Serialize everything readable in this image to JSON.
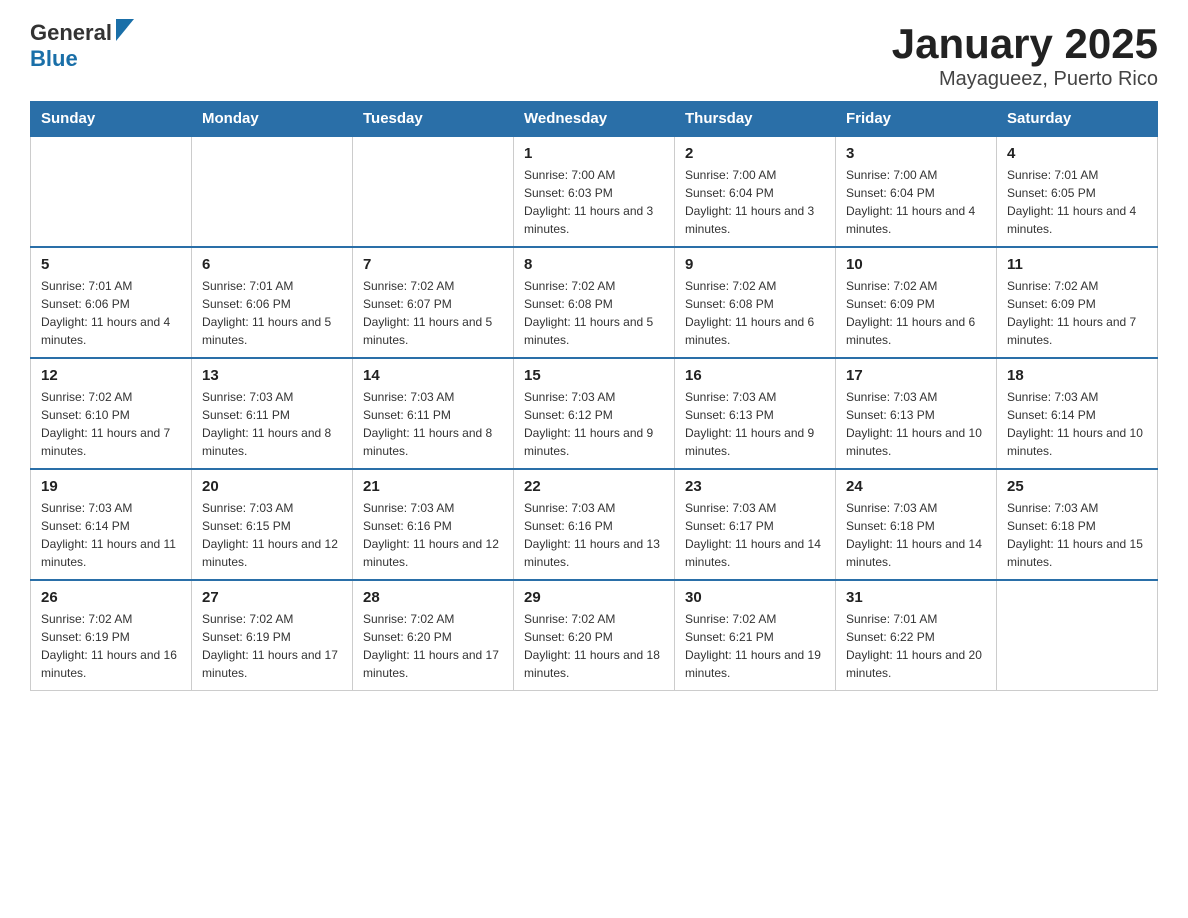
{
  "header": {
    "logo": {
      "general": "General",
      "blue": "Blue"
    },
    "title": "January 2025",
    "subtitle": "Mayagueez, Puerto Rico"
  },
  "weekdays": [
    "Sunday",
    "Monday",
    "Tuesday",
    "Wednesday",
    "Thursday",
    "Friday",
    "Saturday"
  ],
  "weeks": [
    [
      {
        "day": "",
        "info": ""
      },
      {
        "day": "",
        "info": ""
      },
      {
        "day": "",
        "info": ""
      },
      {
        "day": "1",
        "info": "Sunrise: 7:00 AM\nSunset: 6:03 PM\nDaylight: 11 hours and 3 minutes."
      },
      {
        "day": "2",
        "info": "Sunrise: 7:00 AM\nSunset: 6:04 PM\nDaylight: 11 hours and 3 minutes."
      },
      {
        "day": "3",
        "info": "Sunrise: 7:00 AM\nSunset: 6:04 PM\nDaylight: 11 hours and 4 minutes."
      },
      {
        "day": "4",
        "info": "Sunrise: 7:01 AM\nSunset: 6:05 PM\nDaylight: 11 hours and 4 minutes."
      }
    ],
    [
      {
        "day": "5",
        "info": "Sunrise: 7:01 AM\nSunset: 6:06 PM\nDaylight: 11 hours and 4 minutes."
      },
      {
        "day": "6",
        "info": "Sunrise: 7:01 AM\nSunset: 6:06 PM\nDaylight: 11 hours and 5 minutes."
      },
      {
        "day": "7",
        "info": "Sunrise: 7:02 AM\nSunset: 6:07 PM\nDaylight: 11 hours and 5 minutes."
      },
      {
        "day": "8",
        "info": "Sunrise: 7:02 AM\nSunset: 6:08 PM\nDaylight: 11 hours and 5 minutes."
      },
      {
        "day": "9",
        "info": "Sunrise: 7:02 AM\nSunset: 6:08 PM\nDaylight: 11 hours and 6 minutes."
      },
      {
        "day": "10",
        "info": "Sunrise: 7:02 AM\nSunset: 6:09 PM\nDaylight: 11 hours and 6 minutes."
      },
      {
        "day": "11",
        "info": "Sunrise: 7:02 AM\nSunset: 6:09 PM\nDaylight: 11 hours and 7 minutes."
      }
    ],
    [
      {
        "day": "12",
        "info": "Sunrise: 7:02 AM\nSunset: 6:10 PM\nDaylight: 11 hours and 7 minutes."
      },
      {
        "day": "13",
        "info": "Sunrise: 7:03 AM\nSunset: 6:11 PM\nDaylight: 11 hours and 8 minutes."
      },
      {
        "day": "14",
        "info": "Sunrise: 7:03 AM\nSunset: 6:11 PM\nDaylight: 11 hours and 8 minutes."
      },
      {
        "day": "15",
        "info": "Sunrise: 7:03 AM\nSunset: 6:12 PM\nDaylight: 11 hours and 9 minutes."
      },
      {
        "day": "16",
        "info": "Sunrise: 7:03 AM\nSunset: 6:13 PM\nDaylight: 11 hours and 9 minutes."
      },
      {
        "day": "17",
        "info": "Sunrise: 7:03 AM\nSunset: 6:13 PM\nDaylight: 11 hours and 10 minutes."
      },
      {
        "day": "18",
        "info": "Sunrise: 7:03 AM\nSunset: 6:14 PM\nDaylight: 11 hours and 10 minutes."
      }
    ],
    [
      {
        "day": "19",
        "info": "Sunrise: 7:03 AM\nSunset: 6:14 PM\nDaylight: 11 hours and 11 minutes."
      },
      {
        "day": "20",
        "info": "Sunrise: 7:03 AM\nSunset: 6:15 PM\nDaylight: 11 hours and 12 minutes."
      },
      {
        "day": "21",
        "info": "Sunrise: 7:03 AM\nSunset: 6:16 PM\nDaylight: 11 hours and 12 minutes."
      },
      {
        "day": "22",
        "info": "Sunrise: 7:03 AM\nSunset: 6:16 PM\nDaylight: 11 hours and 13 minutes."
      },
      {
        "day": "23",
        "info": "Sunrise: 7:03 AM\nSunset: 6:17 PM\nDaylight: 11 hours and 14 minutes."
      },
      {
        "day": "24",
        "info": "Sunrise: 7:03 AM\nSunset: 6:18 PM\nDaylight: 11 hours and 14 minutes."
      },
      {
        "day": "25",
        "info": "Sunrise: 7:03 AM\nSunset: 6:18 PM\nDaylight: 11 hours and 15 minutes."
      }
    ],
    [
      {
        "day": "26",
        "info": "Sunrise: 7:02 AM\nSunset: 6:19 PM\nDaylight: 11 hours and 16 minutes."
      },
      {
        "day": "27",
        "info": "Sunrise: 7:02 AM\nSunset: 6:19 PM\nDaylight: 11 hours and 17 minutes."
      },
      {
        "day": "28",
        "info": "Sunrise: 7:02 AM\nSunset: 6:20 PM\nDaylight: 11 hours and 17 minutes."
      },
      {
        "day": "29",
        "info": "Sunrise: 7:02 AM\nSunset: 6:20 PM\nDaylight: 11 hours and 18 minutes."
      },
      {
        "day": "30",
        "info": "Sunrise: 7:02 AM\nSunset: 6:21 PM\nDaylight: 11 hours and 19 minutes."
      },
      {
        "day": "31",
        "info": "Sunrise: 7:01 AM\nSunset: 6:22 PM\nDaylight: 11 hours and 20 minutes."
      },
      {
        "day": "",
        "info": ""
      }
    ]
  ]
}
